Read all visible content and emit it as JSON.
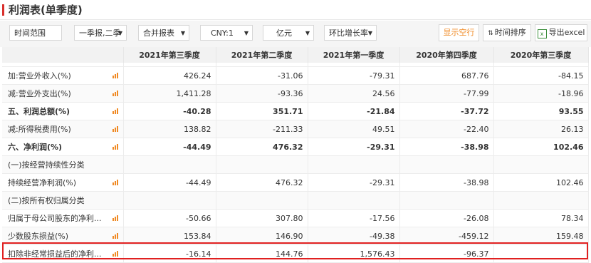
{
  "title": "利润表(单季度)",
  "toolbar": {
    "time_range": "时间范围",
    "period_select": "一季报,二季",
    "report_type": "合并报表",
    "currency": "CNY:1",
    "unit": "亿元",
    "growth": "环比增长率",
    "show_empty": "显示空行",
    "time_sort": "时间排序",
    "export": "导出excel"
  },
  "table": {
    "columns": [
      "2021年第三季度",
      "2021年第二季度",
      "2021年第一季度",
      "2020年第四季度",
      "2020年第三季度"
    ],
    "rows": [
      {
        "label": "加:营业外收入(%)",
        "values": [
          "426.24",
          "-31.06",
          "-79.31",
          "687.76",
          "-84.15"
        ],
        "bold": false,
        "chart": true
      },
      {
        "label": "减:营业外支出(%)",
        "values": [
          "1,411.28",
          "-93.36",
          "24.56",
          "-77.99",
          "-18.96"
        ],
        "bold": false,
        "chart": true
      },
      {
        "label": "五、利润总额(%)",
        "values": [
          "-40.28",
          "351.71",
          "-21.84",
          "-37.72",
          "93.55"
        ],
        "bold": true,
        "chart": true
      },
      {
        "label": "减:所得税费用(%)",
        "values": [
          "138.82",
          "-211.33",
          "49.51",
          "-22.40",
          "26.13"
        ],
        "bold": false,
        "chart": true
      },
      {
        "label": "六、净利润(%)",
        "values": [
          "-44.49",
          "476.32",
          "-29.31",
          "-38.98",
          "102.46"
        ],
        "bold": true,
        "chart": true
      },
      {
        "label": "(一)按经营持续性分类",
        "values": [
          "",
          "",
          "",
          "",
          ""
        ],
        "bold": false,
        "chart": false
      },
      {
        "label": "持续经营净利润(%)",
        "values": [
          "-44.49",
          "476.32",
          "-29.31",
          "-38.98",
          "102.46"
        ],
        "bold": false,
        "chart": true
      },
      {
        "label": "(二)按所有权归属分类",
        "values": [
          "",
          "",
          "",
          "",
          ""
        ],
        "bold": false,
        "chart": false
      },
      {
        "label": "归属于母公司股东的净利...",
        "values": [
          "-50.66",
          "307.80",
          "-17.56",
          "-26.08",
          "78.34"
        ],
        "bold": false,
        "chart": true
      },
      {
        "label": "少数股东损益(%)",
        "values": [
          "153.84",
          "146.90",
          "-49.38",
          "-459.12",
          "159.48"
        ],
        "bold": false,
        "chart": true
      },
      {
        "label": "扣除非经常损益后的净利...",
        "values": [
          "-16.14",
          "144.76",
          "1,576.43",
          "-96.37",
          ""
        ],
        "bold": false,
        "chart": true
      }
    ]
  },
  "colors": {
    "accent": "#d9302d",
    "orange": "#f08a24",
    "highlight": "#e02020",
    "header_bg": "#f2f2f2"
  }
}
